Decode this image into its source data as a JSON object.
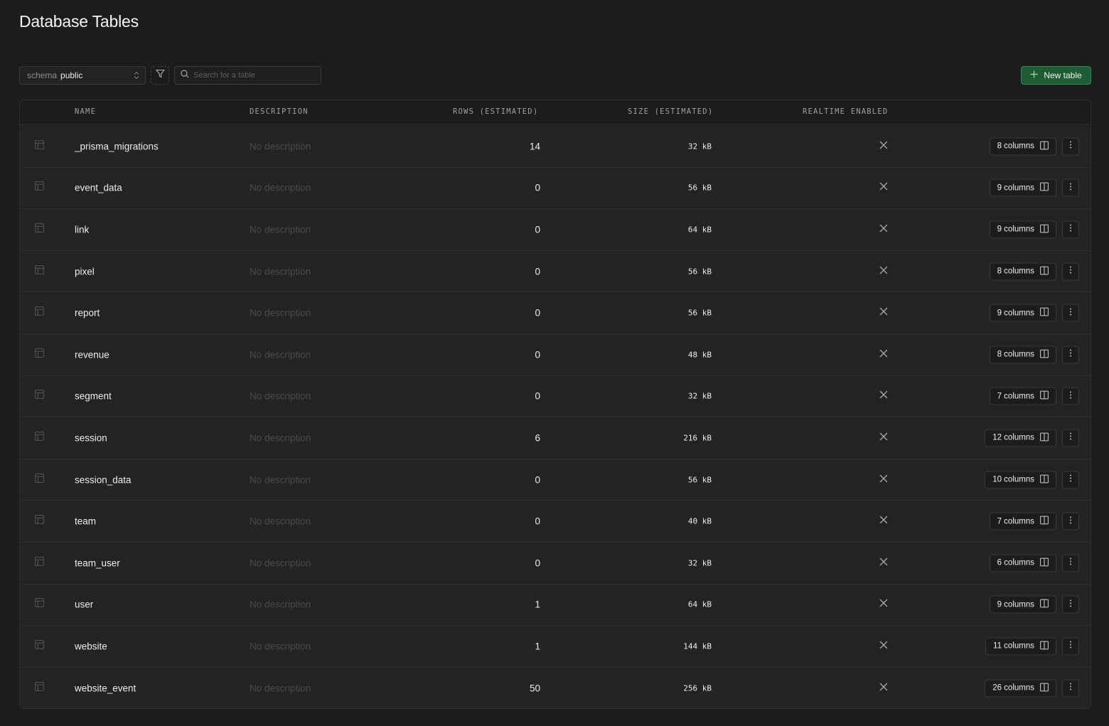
{
  "page": {
    "title": "Database Tables"
  },
  "toolbar": {
    "schema_label": "schema",
    "schema_value": "public",
    "search_placeholder": "Search for a table",
    "new_table_label": "New table"
  },
  "table": {
    "headers": {
      "name": "NAME",
      "description": "DESCRIPTION",
      "rows": "ROWS (ESTIMATED)",
      "size": "SIZE (ESTIMATED)",
      "realtime": "REALTIME ENABLED"
    },
    "rows": [
      {
        "name": "_prisma_migrations",
        "description": "No description",
        "rows": "14",
        "size": "32 kB",
        "columns": "8 columns"
      },
      {
        "name": "event_data",
        "description": "No description",
        "rows": "0",
        "size": "56 kB",
        "columns": "9 columns"
      },
      {
        "name": "link",
        "description": "No description",
        "rows": "0",
        "size": "64 kB",
        "columns": "9 columns"
      },
      {
        "name": "pixel",
        "description": "No description",
        "rows": "0",
        "size": "56 kB",
        "columns": "8 columns"
      },
      {
        "name": "report",
        "description": "No description",
        "rows": "0",
        "size": "56 kB",
        "columns": "9 columns"
      },
      {
        "name": "revenue",
        "description": "No description",
        "rows": "0",
        "size": "48 kB",
        "columns": "8 columns"
      },
      {
        "name": "segment",
        "description": "No description",
        "rows": "0",
        "size": "32 kB",
        "columns": "7 columns"
      },
      {
        "name": "session",
        "description": "No description",
        "rows": "6",
        "size": "216 kB",
        "columns": "12 columns"
      },
      {
        "name": "session_data",
        "description": "No description",
        "rows": "0",
        "size": "56 kB",
        "columns": "10 columns"
      },
      {
        "name": "team",
        "description": "No description",
        "rows": "0",
        "size": "40 kB",
        "columns": "7 columns"
      },
      {
        "name": "team_user",
        "description": "No description",
        "rows": "0",
        "size": "32 kB",
        "columns": "6 columns"
      },
      {
        "name": "user",
        "description": "No description",
        "rows": "1",
        "size": "64 kB",
        "columns": "9 columns"
      },
      {
        "name": "website",
        "description": "No description",
        "rows": "1",
        "size": "144 kB",
        "columns": "11 columns"
      },
      {
        "name": "website_event",
        "description": "No description",
        "rows": "50",
        "size": "256 kB",
        "columns": "26 columns"
      }
    ]
  },
  "colors": {
    "background": "#1c1c1c",
    "row": "#232323",
    "accent": "#1e5c36",
    "accent_border": "#2e8a52"
  },
  "icons": {
    "table_icon": "table-grid-icon",
    "realtime_icon": "x-icon",
    "columns_icon": "columns-icon",
    "more_icon": "more-vertical-icon"
  }
}
